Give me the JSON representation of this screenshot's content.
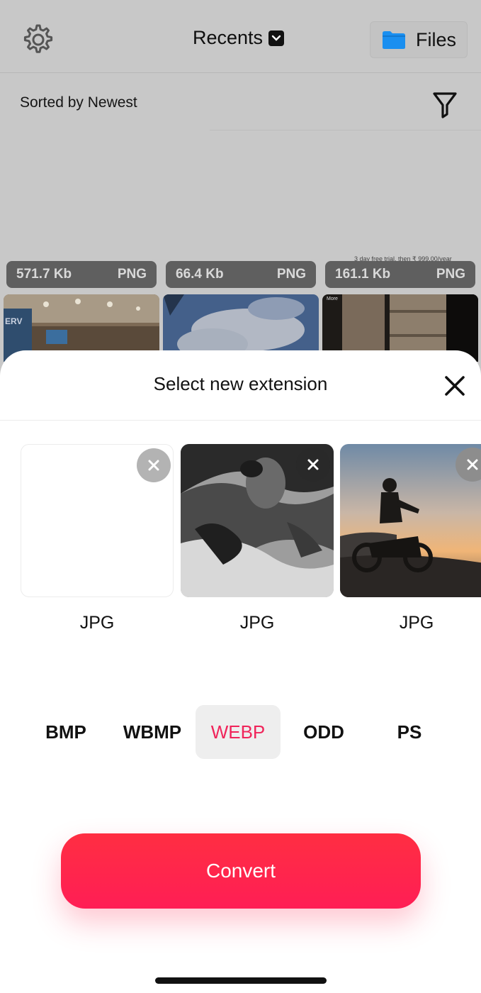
{
  "header": {
    "title": "Recents",
    "files_label": "Files"
  },
  "sort": {
    "label": "Sorted by Newest"
  },
  "recents": {
    "banner_text": "3 day free trial, then ₹ 999.00/year",
    "items": [
      {
        "size": "571.7 Kb",
        "type": "PNG"
      },
      {
        "size": "66.4 Kb",
        "type": "PNG"
      },
      {
        "size": "161.1 Kb",
        "type": "PNG"
      }
    ]
  },
  "sheet": {
    "title": "Select new extension",
    "selected_images": [
      {
        "format": "JPG"
      },
      {
        "format": "JPG"
      },
      {
        "format": "JPG"
      }
    ],
    "extensions": [
      "BMP",
      "WBMP",
      "WEBP",
      "ODD",
      "PS"
    ],
    "selected_extension": "WEBP",
    "convert_label": "Convert"
  },
  "colors": {
    "accent": "#f0245a",
    "convert_button": "#ff2645",
    "file_folder": "#1a8ff0"
  }
}
